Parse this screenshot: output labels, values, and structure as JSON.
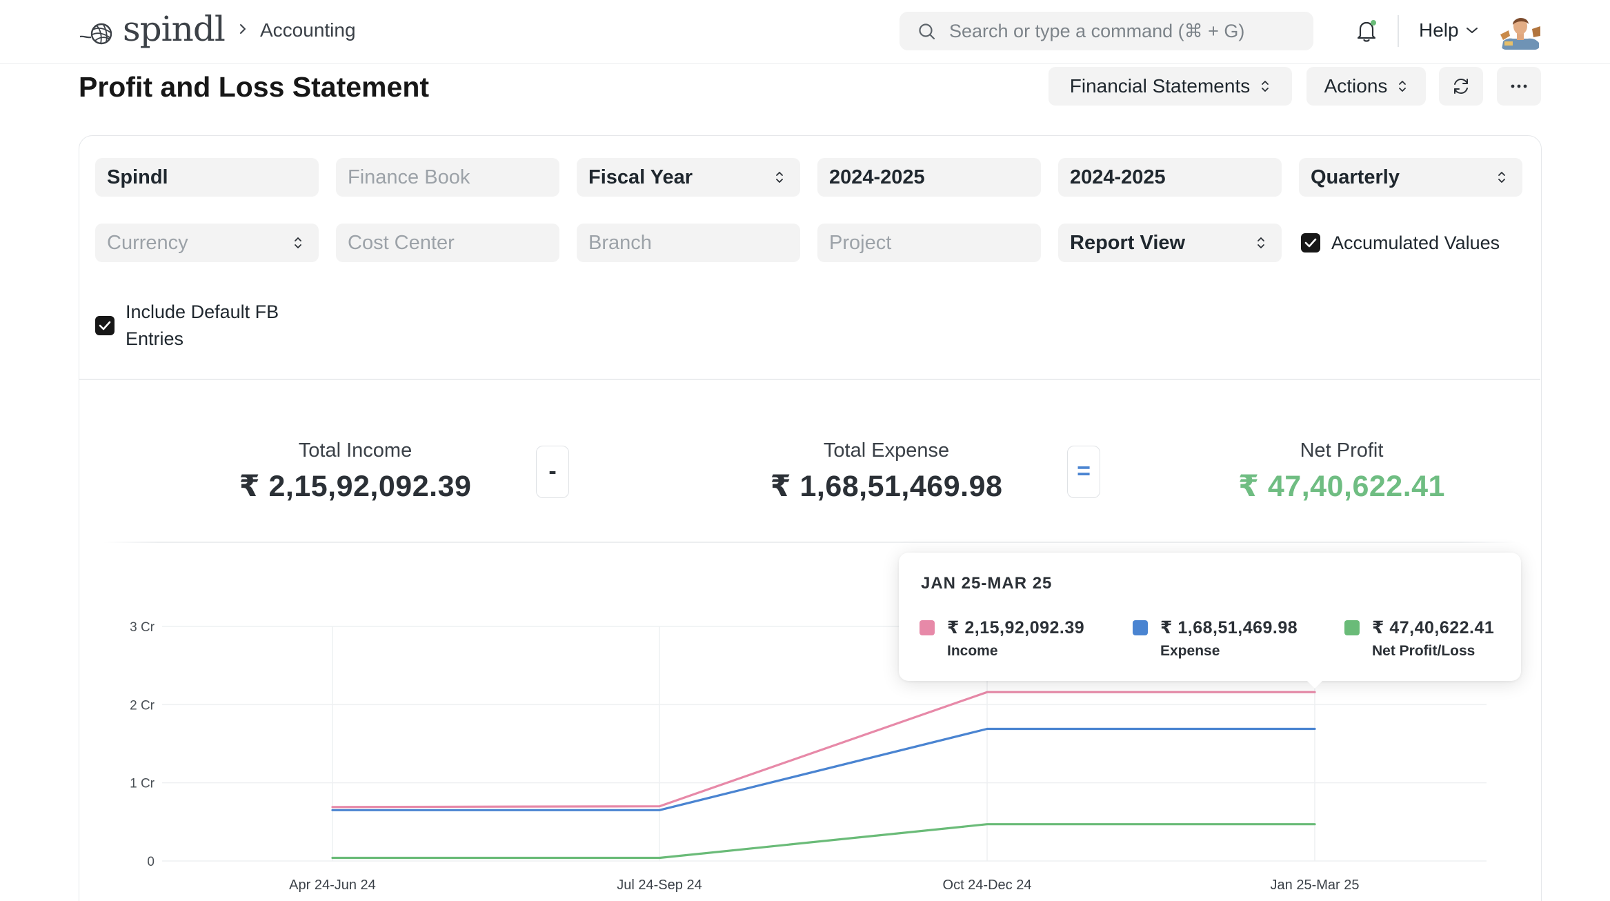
{
  "app": {
    "logo_text": "spindl",
    "breadcrumb": "Accounting"
  },
  "navbar": {
    "search_placeholder": "Search or type a command (⌘ + G)",
    "help_label": "Help"
  },
  "page": {
    "title": "Profit and Loss Statement",
    "buttons": {
      "financial_statements": "Financial Statements",
      "actions": "Actions"
    }
  },
  "filters": {
    "company": "Spindl",
    "finance_book_placeholder": "Finance Book",
    "filter_based_on": "Fiscal Year",
    "from_fiscal_year": "2024-2025",
    "to_fiscal_year": "2024-2025",
    "periodicity": "Quarterly",
    "currency_placeholder": "Currency",
    "cost_center_placeholder": "Cost Center",
    "branch_placeholder": "Branch",
    "project_placeholder": "Project",
    "report_view": "Report View",
    "accumulated_values_label": "Accumulated Values",
    "accumulated_values_checked": true,
    "include_default_fb_line1": "Include Default FB",
    "include_default_fb_line2": "Entries",
    "include_default_fb_checked": true
  },
  "summary": {
    "income_label": "Total Income",
    "income_value": "₹ 2,15,92,092.39",
    "minus_symbol": "-",
    "expense_label": "Total Expense",
    "expense_value": "₹ 1,68,51,469.98",
    "equals_symbol": "=",
    "net_label": "Net Profit",
    "net_value": "₹ 47,40,622.41"
  },
  "chart_data": {
    "type": "line",
    "categories": [
      "Apr 24-Jun 24",
      "Jul 24-Sep 24",
      "Oct 24-Dec 24",
      "Jan 25-Mar 25"
    ],
    "y_ticks": [
      "0",
      "1 Cr",
      "2 Cr",
      "3 Cr"
    ],
    "ylim": [
      0,
      3
    ],
    "y_unit": "Cr",
    "series": [
      {
        "name": "Income",
        "color": "#e789a8",
        "values": [
          0.69,
          0.7,
          2.16,
          2.16
        ]
      },
      {
        "name": "Expense",
        "color": "#4a84d1",
        "values": [
          0.65,
          0.65,
          1.69,
          1.69
        ]
      },
      {
        "name": "Net Profit/Loss",
        "color": "#6abb78",
        "values": [
          0.04,
          0.04,
          0.47,
          0.47
        ]
      }
    ],
    "grid": true
  },
  "tooltip": {
    "title": "JAN 25-MAR 25",
    "items": [
      {
        "value": "₹ 2,15,92,092.39",
        "name": "Income",
        "color": "#e789a8"
      },
      {
        "value": "₹ 1,68,51,469.98",
        "name": "Expense",
        "color": "#4a84d1"
      },
      {
        "value": "₹ 47,40,622.41",
        "name": "Net Profit/Loss",
        "color": "#6abb78"
      }
    ]
  }
}
